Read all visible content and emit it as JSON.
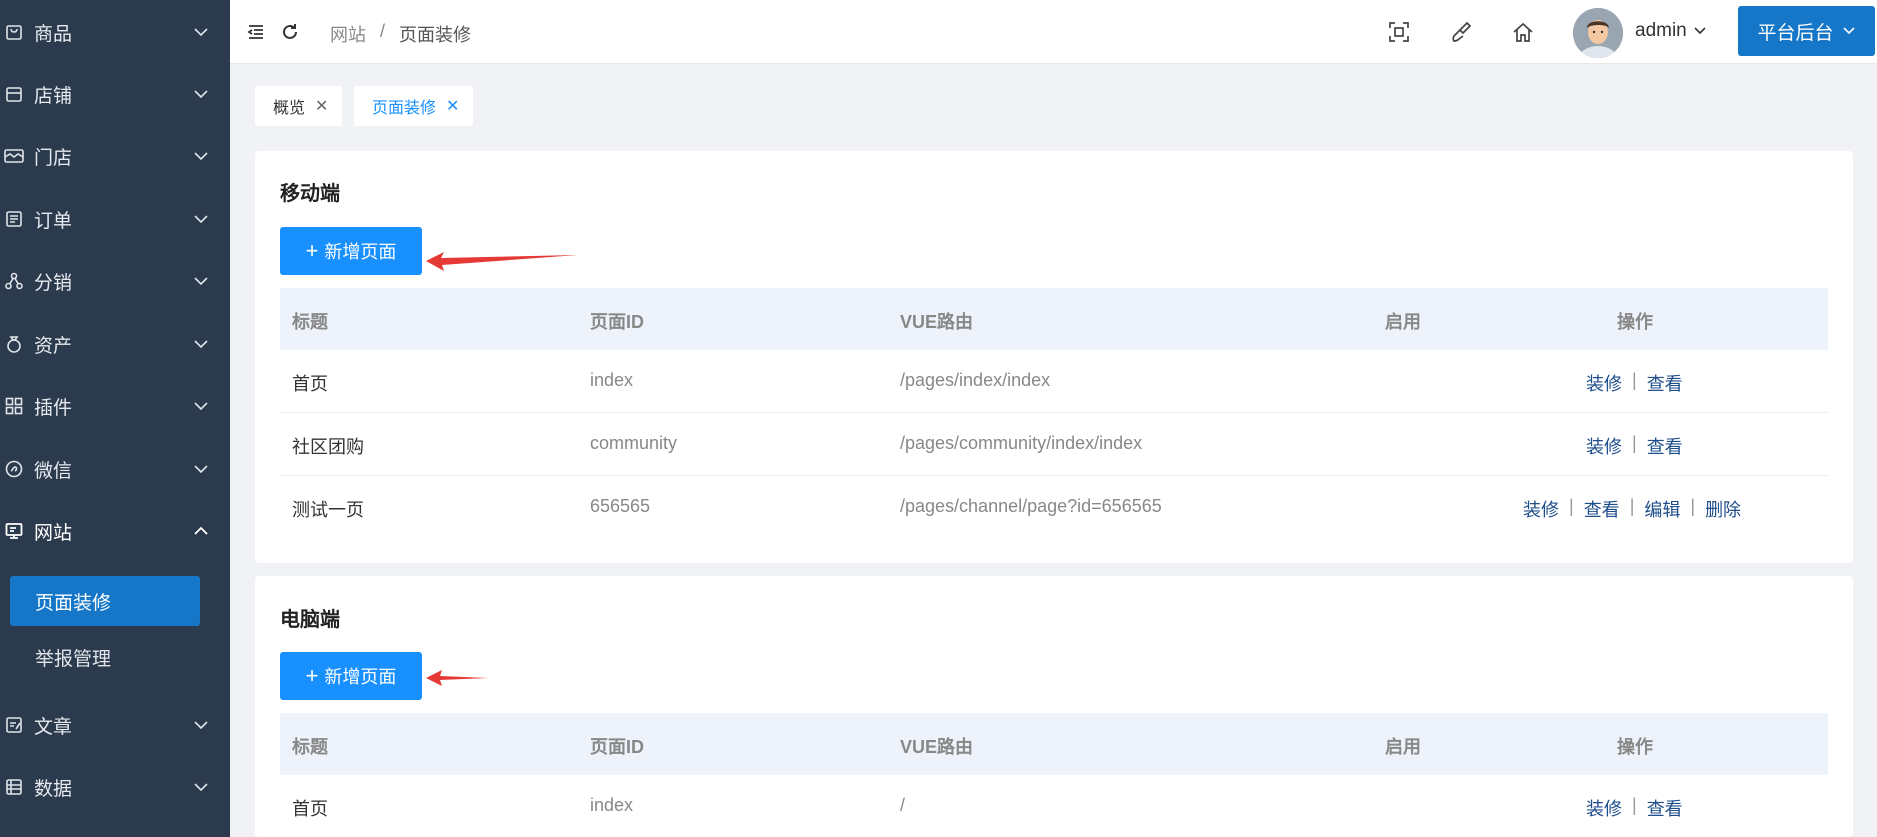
{
  "sidebar": {
    "items": [
      {
        "label": "商品",
        "icon": "bag-icon"
      },
      {
        "label": "店铺",
        "icon": "shop-icon"
      },
      {
        "label": "门店",
        "icon": "store-icon"
      },
      {
        "label": "订单",
        "icon": "order-icon"
      },
      {
        "label": "分销",
        "icon": "distribution-icon"
      },
      {
        "label": "资产",
        "icon": "asset-icon"
      },
      {
        "label": "插件",
        "icon": "plugin-icon"
      },
      {
        "label": "微信",
        "icon": "wechat-icon"
      },
      {
        "label": "网站",
        "icon": "website-icon"
      },
      {
        "label": "文章",
        "icon": "article-icon"
      },
      {
        "label": "数据",
        "icon": "data-icon"
      }
    ],
    "submenu": [
      {
        "label": "页面装修",
        "active": true
      },
      {
        "label": "举报管理",
        "active": false
      }
    ]
  },
  "header": {
    "breadcrumb": [
      "网站",
      "/",
      "页面装修"
    ],
    "user": "admin",
    "platform_button": "平台后台"
  },
  "tabs": [
    {
      "label": "概览",
      "active": false
    },
    {
      "label": "页面装修",
      "active": true
    }
  ],
  "mobile": {
    "title": "移动端",
    "add_button": "新增页面",
    "columns": [
      "标题",
      "页面ID",
      "VUE路由",
      "启用",
      "操作"
    ],
    "rows": [
      {
        "title": "首页",
        "id": "index",
        "route": "/pages/index/index",
        "ops": [
          "装修",
          "查看"
        ]
      },
      {
        "title": "社区团购",
        "id": "community",
        "route": "/pages/community/index/index",
        "ops": [
          "装修",
          "查看"
        ]
      },
      {
        "title": "测试一页",
        "id": "656565",
        "route": "/pages/channel/page?id=656565",
        "ops": [
          "装修",
          "查看",
          "编辑",
          "删除"
        ]
      }
    ]
  },
  "pc": {
    "title": "电脑端",
    "add_button": "新增页面",
    "columns": [
      "标题",
      "页面ID",
      "VUE路由",
      "启用",
      "操作"
    ],
    "rows": [
      {
        "title": "首页",
        "id": "index",
        "route": "/",
        "ops": [
          "装修",
          "查看"
        ]
      }
    ]
  },
  "colors": {
    "sidebar_bg": "#2b3a4d",
    "accent": "#1677c9",
    "primary_button": "#1890ff",
    "annotation_arrow": "#e53935"
  }
}
